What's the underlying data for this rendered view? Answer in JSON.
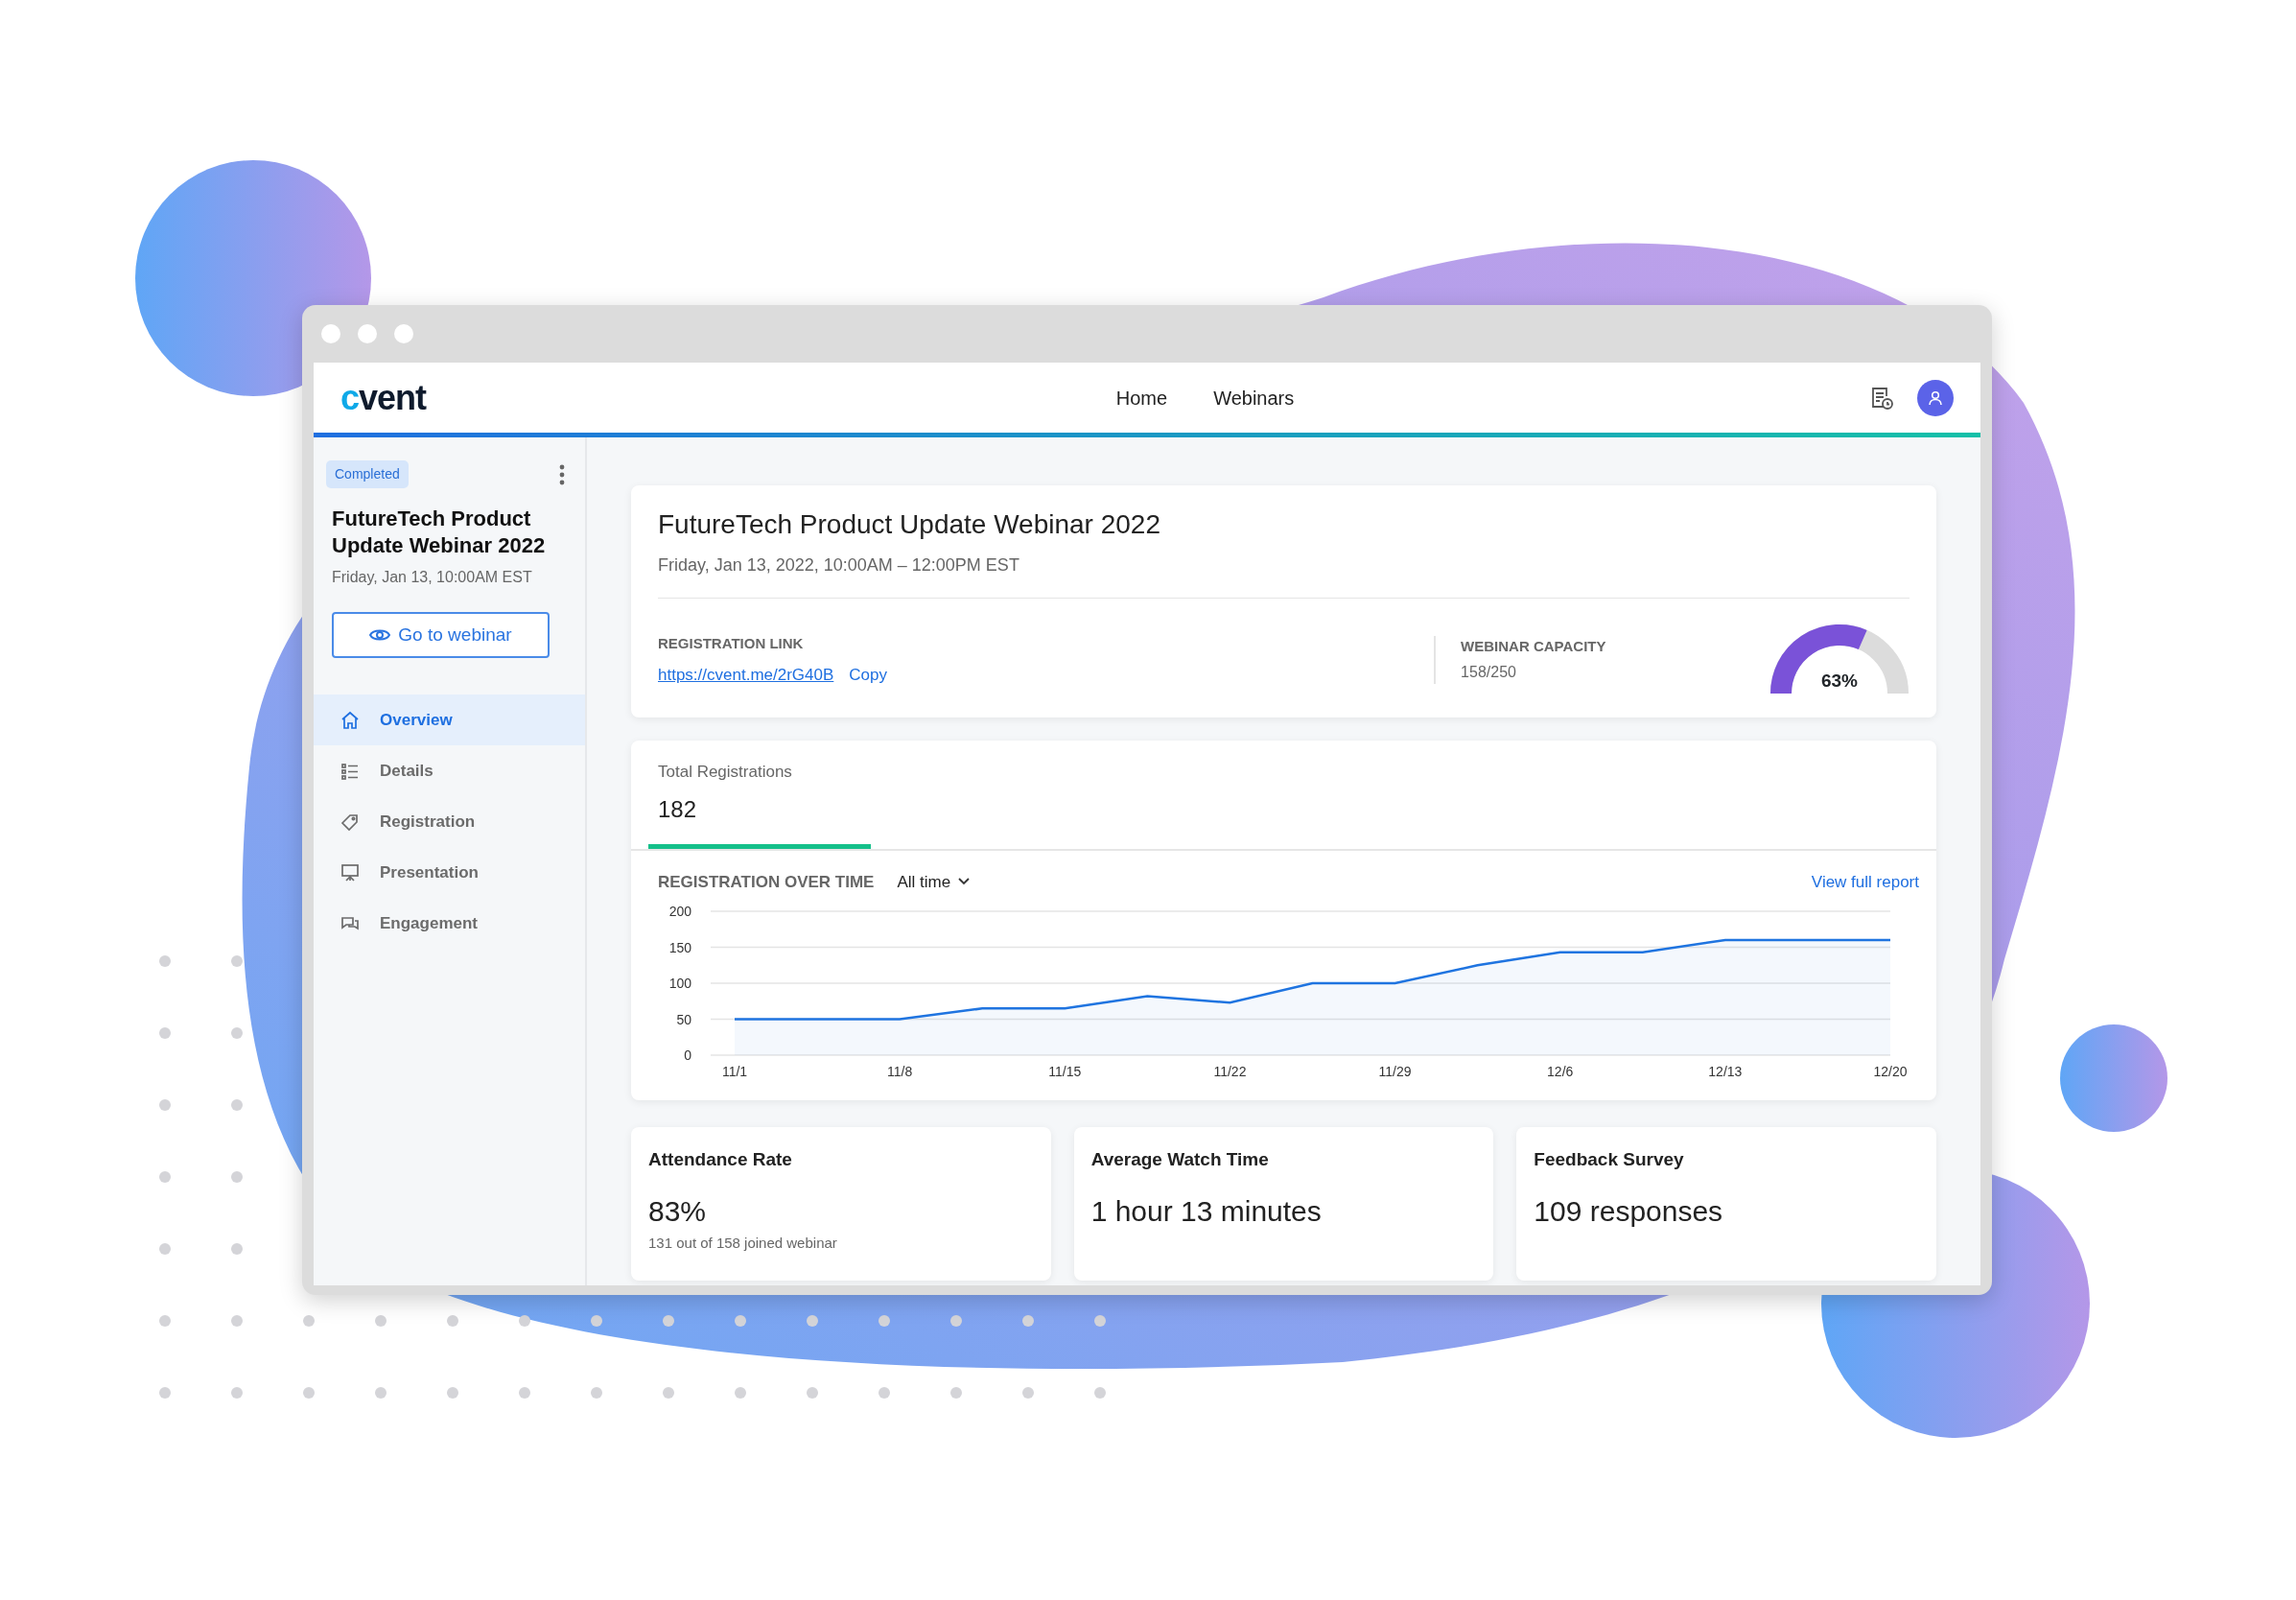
{
  "navbar": {
    "logo": "cvent",
    "links": [
      {
        "label": "Home"
      },
      {
        "label": "Webinars"
      }
    ]
  },
  "sidebar": {
    "status": "Completed",
    "title": "FutureTech Product Update Webinar 2022",
    "date": "Friday, Jan 13, 10:00AM EST",
    "button": "Go to webinar",
    "items": [
      {
        "label": "Overview",
        "selected": true
      },
      {
        "label": "Details",
        "selected": false
      },
      {
        "label": "Registration",
        "selected": false
      },
      {
        "label": "Presentation",
        "selected": false
      },
      {
        "label": "Engagement",
        "selected": false
      }
    ]
  },
  "event": {
    "title": "FutureTech Product Update Webinar 2022",
    "date": "Friday, Jan 13, 2022, 10:00AM – 12:00PM EST",
    "link_label": "REGISTRATION LINK",
    "link": "https://cvent.me/2rG40B",
    "copy": "Copy",
    "capacity_label": "WEBINAR CAPACITY",
    "capacity": "158/250",
    "percent": "63%"
  },
  "registrations": {
    "label": "Total Registrations",
    "value": "182",
    "chart_title": "REGISTRATION OVER TIME",
    "range": "All time",
    "report_link": "View full report",
    "chart_data": {
      "type": "area",
      "categories": [
        "11/1",
        null,
        "11/8",
        null,
        "11/15",
        null,
        "11/22",
        null,
        "11/29",
        null,
        "12/6",
        null,
        "12/13",
        null,
        "12/20"
      ],
      "series": [
        {
          "color": "#1f74e0",
          "values": [
            50,
            50,
            50,
            65,
            65,
            82,
            73,
            100,
            100,
            125,
            143,
            143,
            160,
            160,
            160
          ]
        }
      ],
      "ylim": [
        0,
        200
      ],
      "yticks": [
        0,
        50,
        100,
        150,
        200
      ],
      "grid": true
    }
  },
  "metrics": [
    {
      "title": "Attendance Rate",
      "value": "83%",
      "note": "131 out of 158 joined webinar"
    },
    {
      "title": "Average Watch Time",
      "value": "1 hour 13 minutes"
    },
    {
      "title": "Feedback Survey",
      "value": "109 responses"
    }
  ]
}
